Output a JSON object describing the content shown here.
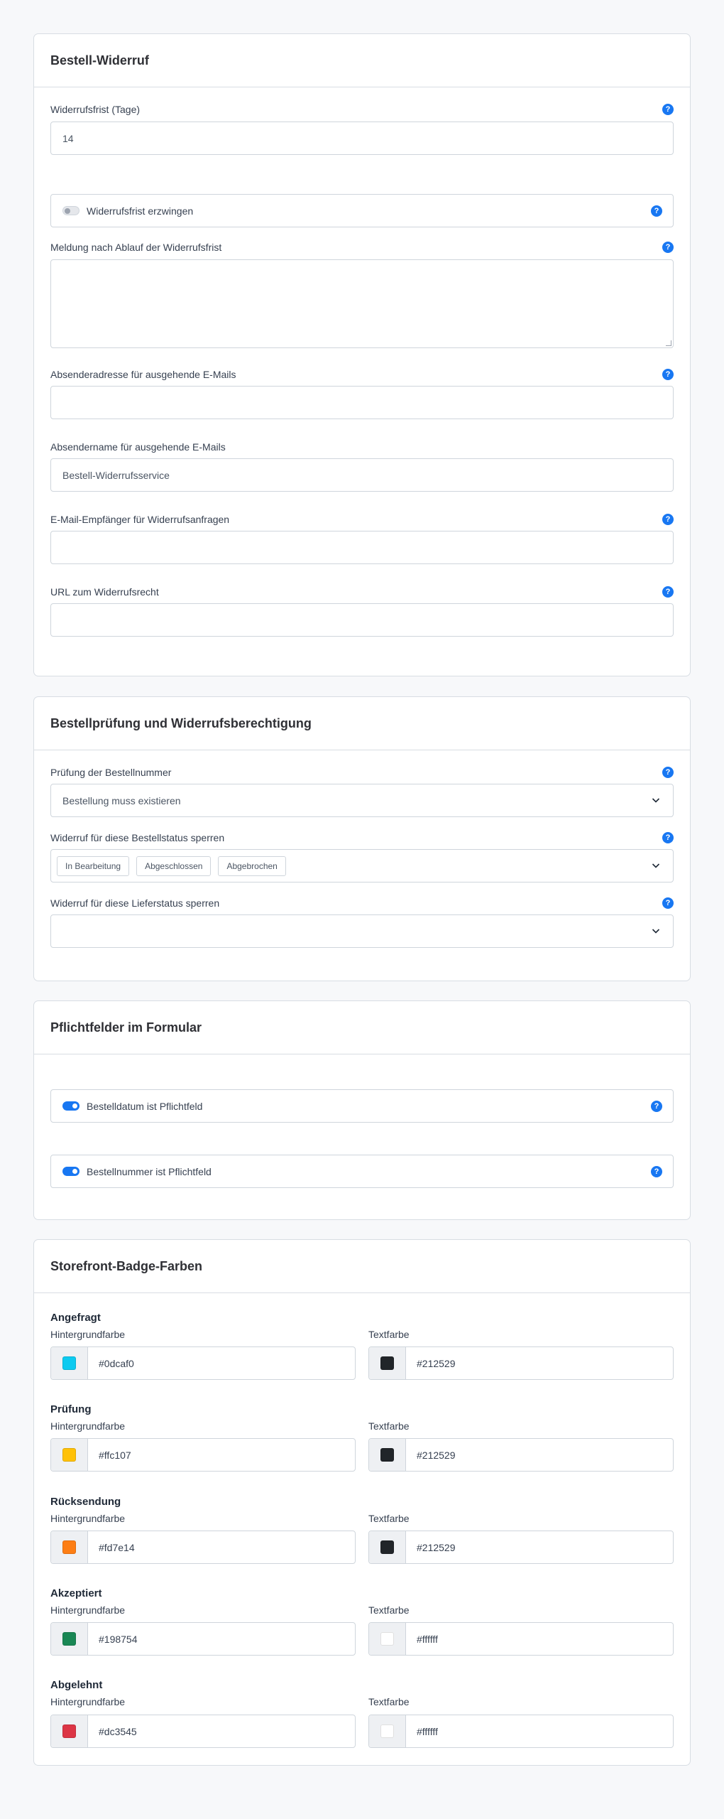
{
  "widerruf": {
    "title": "Bestell-Widerruf",
    "frist_label": "Widerrufsfrist (Tage)",
    "frist_value": "14",
    "erzwingen_label": "Widerrufsfrist erzwingen",
    "erzwingen_on": false,
    "meldung_label": "Meldung nach Ablauf der Widerrufsfrist",
    "meldung_value": "",
    "absender_adresse_label": "Absenderadresse für ausgehende E-Mails",
    "absender_adresse_value": "",
    "absender_name_label": "Absendername für ausgehende E-Mails",
    "absender_name_value": "Bestell-Widerrufsservice",
    "empfaenger_label": "E-Mail-Empfänger für Widerrufsanfragen",
    "empfaenger_value": "",
    "url_label": "URL zum Widerrufsrecht",
    "url_value": ""
  },
  "pruefung": {
    "title": "Bestellprüfung und Widerrufsberechtigung",
    "nummer_label": "Prüfung der Bestellnummer",
    "nummer_value": "Bestellung muss existieren",
    "status_label": "Widerruf für diese Bestellstatus sperren",
    "status_tags": [
      "In Bearbeitung",
      "Abgeschlossen",
      "Abgebrochen"
    ],
    "liefer_label": "Widerruf für diese Lieferstatus sperren",
    "liefer_value": ""
  },
  "pflicht": {
    "title": "Pflichtfelder im Formular",
    "datum_label": "Bestelldatum ist Pflichtfeld",
    "datum_on": true,
    "nummer_label": "Bestellnummer ist Pflichtfeld",
    "nummer_on": true
  },
  "badges": {
    "title": "Storefront-Badge-Farben",
    "bg_label": "Hintergrundfarbe",
    "text_label": "Textfarbe",
    "groups": [
      {
        "name": "Angefragt",
        "bg": "#0dcaf0",
        "text": "#212529"
      },
      {
        "name": "Prüfung",
        "bg": "#ffc107",
        "text": "#212529"
      },
      {
        "name": "Rücksendung",
        "bg": "#fd7e14",
        "text": "#212529"
      },
      {
        "name": "Akzeptiert",
        "bg": "#198754",
        "text": "#ffffff"
      },
      {
        "name": "Abgelehnt",
        "bg": "#dc3545",
        "text": "#ffffff"
      }
    ]
  },
  "help_icon_glyph": "?"
}
